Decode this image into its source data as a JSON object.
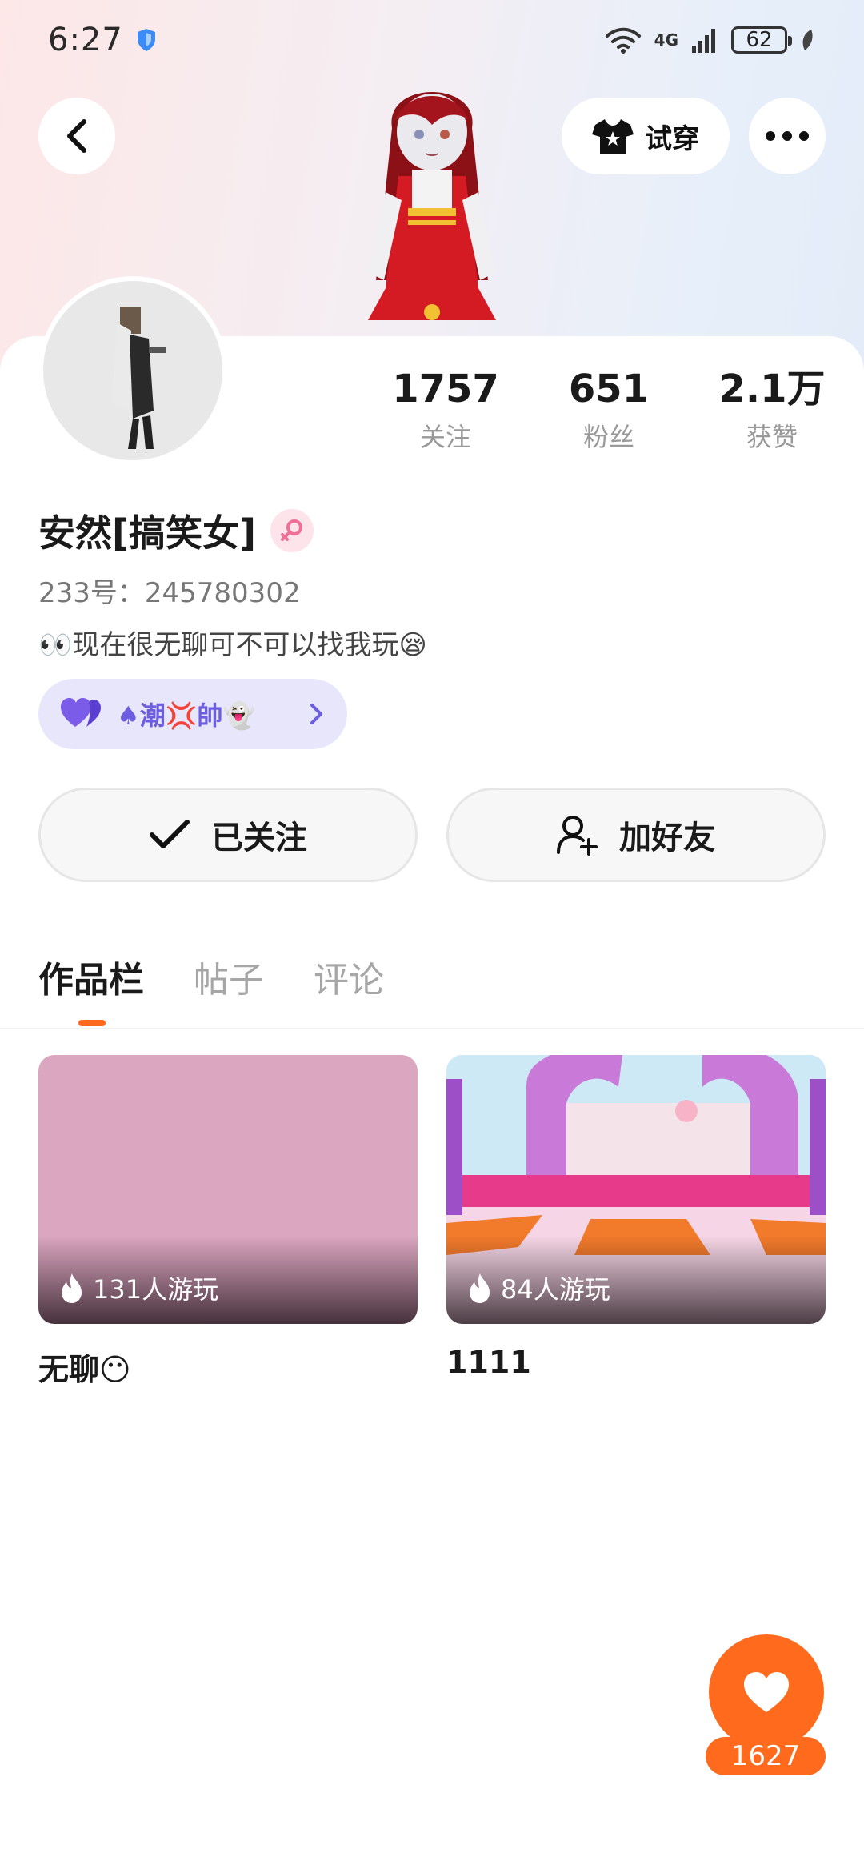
{
  "status_bar": {
    "time": "6:27",
    "network": "4G",
    "battery": "62"
  },
  "header": {
    "tryon_label": "试穿"
  },
  "profile": {
    "stats": [
      {
        "value": "1757",
        "label": "关注"
      },
      {
        "value": "651",
        "label": "粉丝"
      },
      {
        "value": "2.1万",
        "label": "获赞"
      }
    ],
    "name": "安然[搞笑女]",
    "user_id": "233号：245780302",
    "bio": "👀现在很无聊可不可以找我玩😪",
    "tag": "♠潮💢帥👻"
  },
  "actions": {
    "follow_label": "已关注",
    "add_friend_label": "加好友"
  },
  "tabs": [
    {
      "label": "作品栏"
    },
    {
      "label": "帖子"
    },
    {
      "label": "评论"
    }
  ],
  "works": [
    {
      "title": "无聊😶",
      "plays": "131人游玩"
    },
    {
      "title": "1111",
      "plays": "84人游玩"
    }
  ],
  "like": {
    "count": "1627"
  },
  "colors": {
    "accent": "#ff6a1c",
    "tag_bg": "#e8e6fb",
    "tag_text": "#6d5de0",
    "gender_pink": "#ef6f96"
  }
}
